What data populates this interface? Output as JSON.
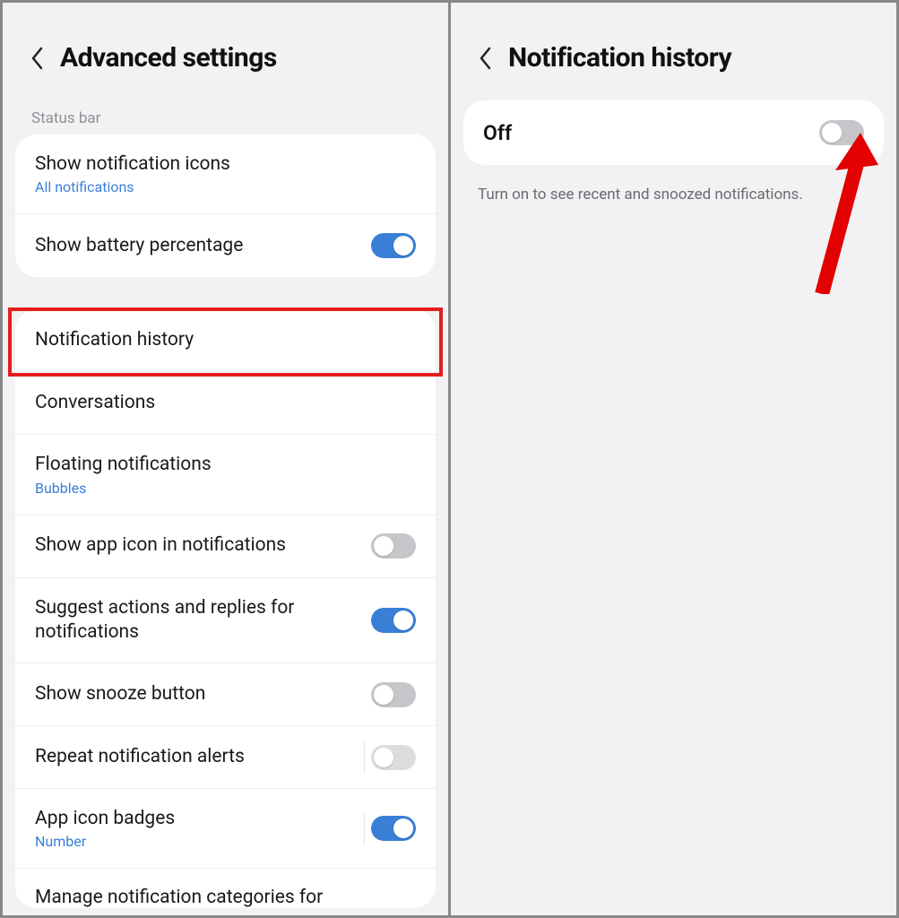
{
  "left": {
    "title": "Advanced settings",
    "section_status_bar": "Status bar",
    "items": {
      "show_notif_icons": {
        "title": "Show notification icons",
        "sub": "All notifications"
      },
      "battery_pct": {
        "title": "Show battery percentage"
      },
      "notif_history": {
        "title": "Notification history"
      },
      "conversations": {
        "title": "Conversations"
      },
      "floating": {
        "title": "Floating notifications",
        "sub": "Bubbles"
      },
      "app_icon_in_notif": {
        "title": "Show app icon in notifications"
      },
      "suggest_actions": {
        "title": "Suggest actions and replies for notifications"
      },
      "snooze_button": {
        "title": "Show snooze button"
      },
      "repeat_alerts": {
        "title": "Repeat notification alerts"
      },
      "app_icon_badges": {
        "title": "App icon badges",
        "sub": "Number"
      },
      "cutoff": "Manage notification categories for"
    }
  },
  "right": {
    "title": "Notification history",
    "state": "Off",
    "description": "Turn on to see recent and snoozed notifications."
  }
}
